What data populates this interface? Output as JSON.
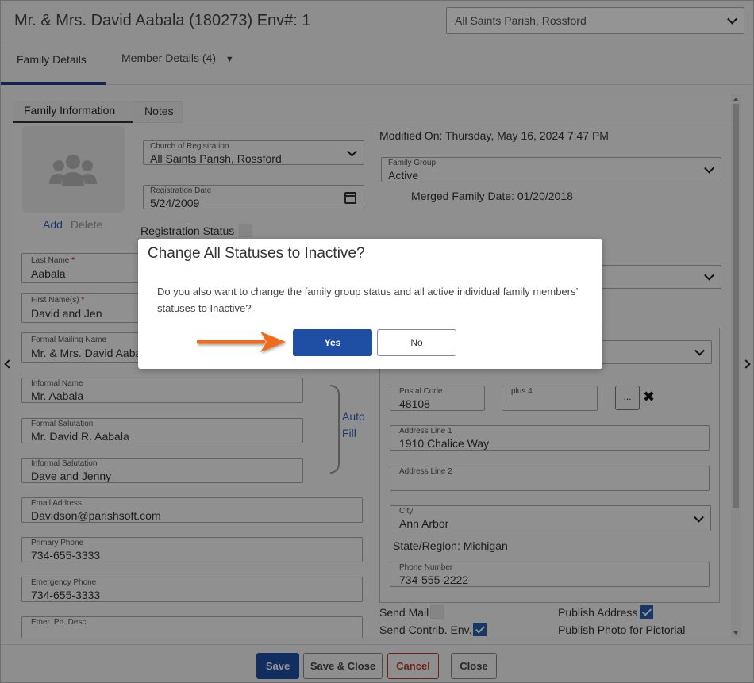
{
  "window": {
    "title": "Mr. & Mrs. David Aabala (180273) Env#: 1",
    "parish_selector": "All Saints Parish, Rossford"
  },
  "tabs": {
    "family_details": "Family Details",
    "member_details": "Member Details (4)",
    "member_details_caret": "▼"
  },
  "subtabs": {
    "family_information": "Family Information",
    "notes": "Notes"
  },
  "photo": {
    "add_label": "Add",
    "delete_label": "Delete"
  },
  "left_fields": {
    "church_of_registration": {
      "label": "Church of Registration",
      "value": "All Saints Parish, Rossford"
    },
    "registration_date": {
      "label": "Registration Date",
      "value": "5/24/2009"
    },
    "registration_status_label": "Registration Status",
    "last_name": {
      "label": "Last Name",
      "value": "Aabala"
    },
    "first_names": {
      "label": "First Name(s)",
      "value": "David and Jen"
    },
    "formal_mailing_name": {
      "label": "Formal Mailing Name",
      "value": "Mr. & Mrs. David Aabala"
    },
    "informal_name": {
      "label": "Informal Name",
      "value": "Mr. Aabala"
    },
    "formal_salutation": {
      "label": "Formal Salutation",
      "value": "Mr. David R. Aabala"
    },
    "informal_salutation": {
      "label": "Informal Salutation",
      "value": "Dave and Jenny"
    },
    "email_address": {
      "label": "Email Address",
      "value": "Davidson@parishsoft.com"
    },
    "primary_phone": {
      "label": "Primary Phone",
      "value": "734-655-3333"
    },
    "emergency_phone": {
      "label": "Emergency Phone",
      "value": "734-655-3333"
    },
    "emer_ph_desc": {
      "label": "Emer. Ph. Desc.",
      "value": ""
    },
    "required_mark": "*",
    "auto_fill_line1": "Auto",
    "auto_fill_line2": "Fill"
  },
  "right_fields": {
    "modified_on": "Modified On: Thursday, May 16, 2024 7:47 PM",
    "family_group": {
      "label": "Family Group",
      "value": "Active"
    },
    "merged_family_date": "Merged Family Date: 01/20/2018",
    "postal_code": {
      "label": "Postal Code",
      "value": "48108"
    },
    "plus4": {
      "label": "plus 4",
      "value": ""
    },
    "lookup_button": "...",
    "clear_glyph": "✖",
    "address_line1": {
      "label": "Address Line 1",
      "value": "1910 Chalice Way"
    },
    "address_line2": {
      "label": "Address Line 2",
      "value": ""
    },
    "city": {
      "label": "City",
      "value": "Ann Arbor"
    },
    "state_region": "State/Region: Michigan",
    "phone_number": {
      "label": "Phone Number",
      "value": "734-555-2222"
    },
    "send_mail": "Send Mail",
    "send_contrib_env": "Send Contrib. Env.",
    "publish_address": "Publish Address",
    "publish_photo": "Publish Photo for Pictorial"
  },
  "footer": {
    "save": "Save",
    "save_close": "Save & Close",
    "cancel": "Cancel",
    "close": "Close"
  },
  "modal": {
    "title": "Change All Statuses to Inactive?",
    "message": "Do you also want to change the family group status and all active individual family members’ statuses to Inactive?",
    "yes": "Yes",
    "no": "No"
  },
  "colors": {
    "primary_blue": "#1f4ea5",
    "cancel_red": "#c0392b",
    "callout_orange": "#f26a1b",
    "link_blue": "#2f5fb0"
  }
}
